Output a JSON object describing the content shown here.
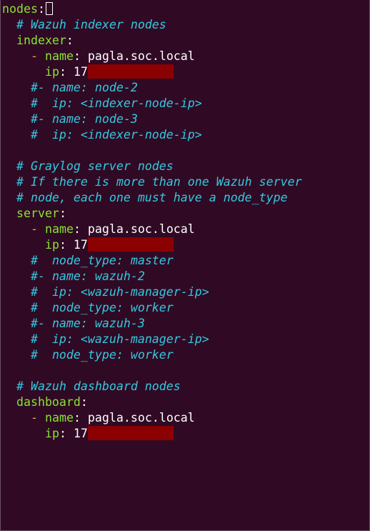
{
  "editor": {
    "lines": [
      {
        "type": "key",
        "indent": "",
        "key": "nodes",
        "cursor": true
      },
      {
        "type": "comment",
        "indent": "  ",
        "text": "# Wazuh indexer nodes"
      },
      {
        "type": "key",
        "indent": "  ",
        "key": "indexer"
      },
      {
        "type": "item",
        "indent": "    ",
        "key": "name",
        "value": "pagla.soc.local"
      },
      {
        "type": "ip",
        "indent": "      ",
        "key": "ip",
        "value": "17",
        "redact_chars": 12
      },
      {
        "type": "comment",
        "indent": "    ",
        "text": "#- name: node-2"
      },
      {
        "type": "comment",
        "indent": "    ",
        "text": "#  ip: <indexer-node-ip>"
      },
      {
        "type": "comment",
        "indent": "    ",
        "text": "#- name: node-3"
      },
      {
        "type": "comment",
        "indent": "    ",
        "text": "#  ip: <indexer-node-ip>"
      },
      {
        "type": "blank"
      },
      {
        "type": "comment",
        "indent": "  ",
        "text": "# Graylog server nodes"
      },
      {
        "type": "comment",
        "indent": "  ",
        "text": "# If there is more than one Wazuh server"
      },
      {
        "type": "comment",
        "indent": "  ",
        "text": "# node, each one must have a node_type"
      },
      {
        "type": "key",
        "indent": "  ",
        "key": "server"
      },
      {
        "type": "item",
        "indent": "    ",
        "key": "name",
        "value": "pagla.soc.local"
      },
      {
        "type": "ip",
        "indent": "      ",
        "key": "ip",
        "value": "17",
        "redact_chars": 12
      },
      {
        "type": "comment",
        "indent": "    ",
        "text": "#  node_type: master"
      },
      {
        "type": "comment",
        "indent": "    ",
        "text": "#- name: wazuh-2"
      },
      {
        "type": "comment",
        "indent": "    ",
        "text": "#  ip: <wazuh-manager-ip>"
      },
      {
        "type": "comment",
        "indent": "    ",
        "text": "#  node_type: worker"
      },
      {
        "type": "comment",
        "indent": "    ",
        "text": "#- name: wazuh-3"
      },
      {
        "type": "comment",
        "indent": "    ",
        "text": "#  ip: <wazuh-manager-ip>"
      },
      {
        "type": "comment",
        "indent": "    ",
        "text": "#  node_type: worker"
      },
      {
        "type": "blank"
      },
      {
        "type": "comment",
        "indent": "  ",
        "text": "# Wazuh dashboard nodes"
      },
      {
        "type": "key",
        "indent": "  ",
        "key": "dashboard"
      },
      {
        "type": "item",
        "indent": "    ",
        "key": "name",
        "value": "pagla.soc.local"
      },
      {
        "type": "ip",
        "indent": "      ",
        "key": "ip",
        "value": "17",
        "redact_chars": 12
      }
    ]
  },
  "colors": {
    "background": "#300a24",
    "key": "#8ae234",
    "list_dash": "#e9a05a",
    "comment": "#34c8e0",
    "text": "#ffffff",
    "redaction": "#8b0000"
  }
}
